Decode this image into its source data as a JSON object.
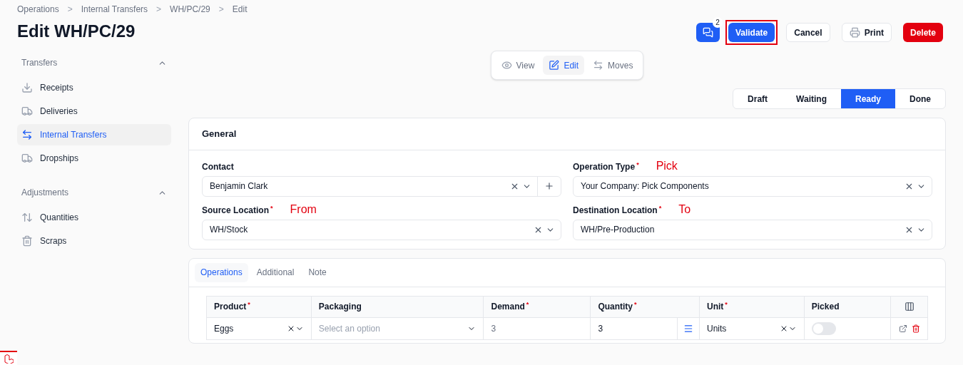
{
  "breadcrumbs": {
    "separator": ">",
    "items": [
      "Operations",
      "Internal Transfers",
      "WH/PC/29",
      "Edit"
    ]
  },
  "required_marker": "*",
  "title": "Edit WH/PC/29",
  "header_actions": {
    "comments_badge": "2",
    "buttons": [
      {
        "label": "Validate",
        "kind": "primary",
        "highlighted": true
      },
      {
        "label": "Cancel",
        "kind": "secondary",
        "highlighted": false
      },
      {
        "label": "Print",
        "kind": "print",
        "highlighted": false
      },
      {
        "label": "Delete",
        "kind": "danger",
        "highlighted": false
      }
    ]
  },
  "sidebar": {
    "groups": [
      {
        "title": "Transfers",
        "expanded": true,
        "items": [
          {
            "label": "Receipts",
            "selected": false
          },
          {
            "label": "Deliveries",
            "selected": false
          },
          {
            "label": "Internal Transfers",
            "selected": true
          },
          {
            "label": "Dropships",
            "selected": false
          }
        ]
      },
      {
        "title": "Adjustments",
        "expanded": true,
        "items": [
          {
            "label": "Quantities",
            "selected": false
          },
          {
            "label": "Scraps",
            "selected": false
          }
        ]
      }
    ]
  },
  "view_switch": [
    {
      "label": "View",
      "selected": false
    },
    {
      "label": "Edit",
      "selected": true
    },
    {
      "label": "Moves",
      "selected": false
    }
  ],
  "status_steps": [
    {
      "label": "Draft",
      "selected": false
    },
    {
      "label": "Waiting",
      "selected": false
    },
    {
      "label": "Ready",
      "selected": true
    },
    {
      "label": "Done",
      "selected": false
    }
  ],
  "general": {
    "title": "General",
    "fields": [
      {
        "label": "Contact",
        "required": false,
        "value": "Benjamin Clark",
        "add_button": true
      },
      {
        "label": "Operation Type",
        "required": true,
        "value": "Your Company: Pick Components",
        "annotation": "Pick",
        "add_button": false
      },
      {
        "label": "Source Location",
        "required": true,
        "value": "WH/Stock",
        "annotation": "From",
        "add_button": false
      },
      {
        "label": "Destination Location",
        "required": true,
        "value": "WH/Pre-Production",
        "annotation": "To",
        "add_button": false
      }
    ]
  },
  "tabs": [
    {
      "label": "Operations",
      "selected": true
    },
    {
      "label": "Additional",
      "selected": false
    },
    {
      "label": "Note",
      "selected": false
    }
  ],
  "table": {
    "columns": [
      {
        "label": "Product",
        "required": true
      },
      {
        "label": "Packaging",
        "required": false
      },
      {
        "label": "Demand",
        "required": true
      },
      {
        "label": "Quantity",
        "required": true
      },
      {
        "label": "Unit",
        "required": true
      },
      {
        "label": "Picked",
        "required": false
      }
    ],
    "rows": [
      {
        "product": "Eggs",
        "packaging_placeholder": "Select an option",
        "demand": "3",
        "quantity": "3",
        "unit": "Units",
        "picked": false
      }
    ]
  }
}
